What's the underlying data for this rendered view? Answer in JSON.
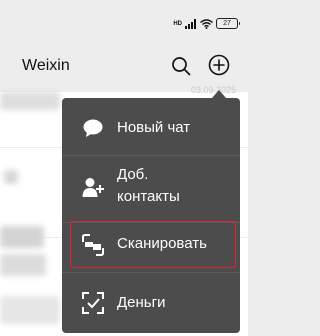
{
  "status_bar": {
    "hd": "HD",
    "battery": "27"
  },
  "header": {
    "title": "Weixin"
  },
  "chat_list": {
    "partial_time": "03.09.2025"
  },
  "menu": {
    "items": [
      {
        "label": "Новый чат",
        "icon": "chat-bubble-icon"
      },
      {
        "label": "Доб.\nконтакты",
        "icon": "add-contact-icon"
      },
      {
        "label": "Сканировать",
        "icon": "scan-icon"
      },
      {
        "label": "Деньги",
        "icon": "money-icon"
      }
    ]
  },
  "colors": {
    "menu_bg": "#4c4c4c",
    "highlight": "#e0232e",
    "page_bg": "#ededed"
  }
}
